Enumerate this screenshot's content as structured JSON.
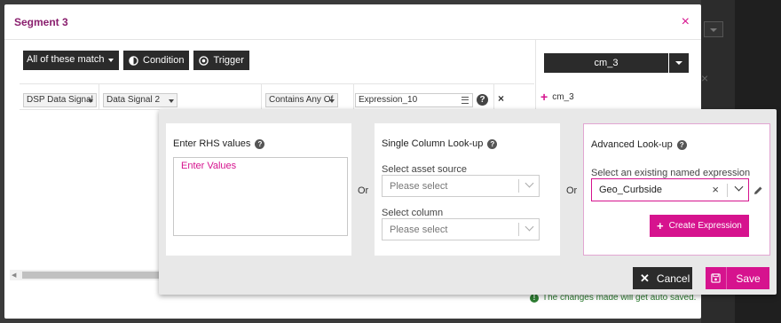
{
  "modal": {
    "title": "Segment 3",
    "close_symbol": "×"
  },
  "toolbar": {
    "match_select": "All of these match",
    "condition_label": "Condition",
    "trigger_label": "Trigger"
  },
  "right_panel": {
    "selected": "cm_3",
    "items": [
      {
        "label": "cm_3"
      }
    ]
  },
  "condition_row": {
    "field_1": "DSP Data Signal",
    "field_2": "Data Signal 2",
    "operator": "Contains Any Of",
    "expression": "Expression_10",
    "help_symbol": "?",
    "remove_symbol": "×"
  },
  "footer": {
    "save_message": "The changes made will get auto saved."
  },
  "popover": {
    "rhs": {
      "title": "Enter RHS values",
      "placeholder": "Enter Values"
    },
    "or_label": "Or",
    "single_column": {
      "title": "Single Column Look-up",
      "asset_label": "Select asset source",
      "asset_value": "Please select",
      "column_label": "Select column",
      "column_value": "Please select"
    },
    "advanced": {
      "title": "Advanced Look-up",
      "expression_label": "Select an existing named expression",
      "expression_value": "Geo_Curbside",
      "clear_symbol": "×",
      "create_button": "Create Expression"
    },
    "cancel_button": "Cancel",
    "save_button": "Save"
  },
  "colors": {
    "accent": "#d6138e",
    "title": "#8a1f6e",
    "dark_button": "#2b2b2b",
    "success": "#2e7d32"
  },
  "icons": [
    "close-icon",
    "contrast-icon",
    "target-icon",
    "chevron-down-icon",
    "plus-icon",
    "list-icon",
    "help-icon",
    "pencil-icon",
    "save-icon",
    "check-circle-icon"
  ]
}
